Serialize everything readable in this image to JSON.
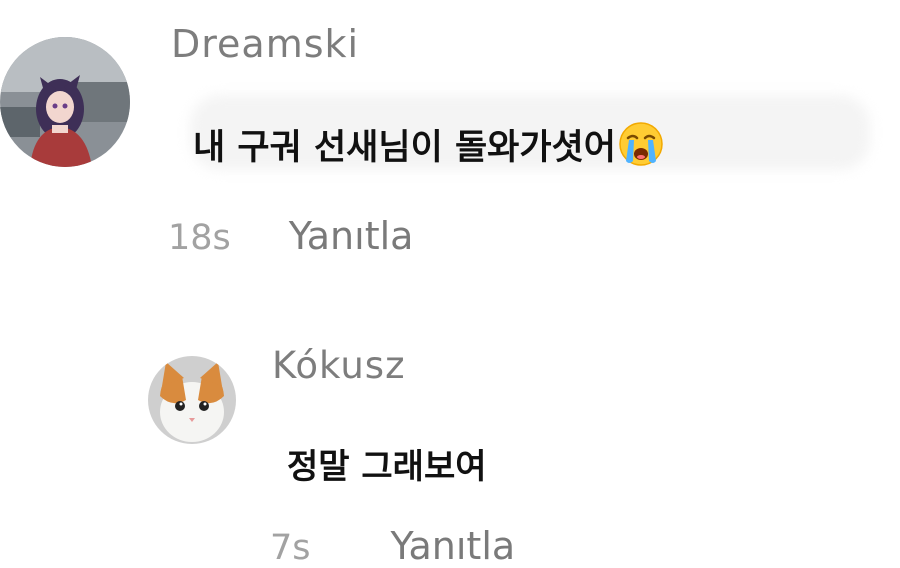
{
  "comments": [
    {
      "username": "Dreamski",
      "text": "내 구궈 선새님이 돌와가셧어",
      "emoji": "loudly-crying-face",
      "time": "18s",
      "reply_label": "Yanıtla"
    },
    {
      "username": "Kókusz",
      "text": "정말 그래보여",
      "time": "7s",
      "reply_label": "Yanıtla"
    }
  ],
  "colors": {
    "username": "#7d7d7d",
    "text": "#111111",
    "meta": "#8e8e8e",
    "background": "#ffffff"
  }
}
